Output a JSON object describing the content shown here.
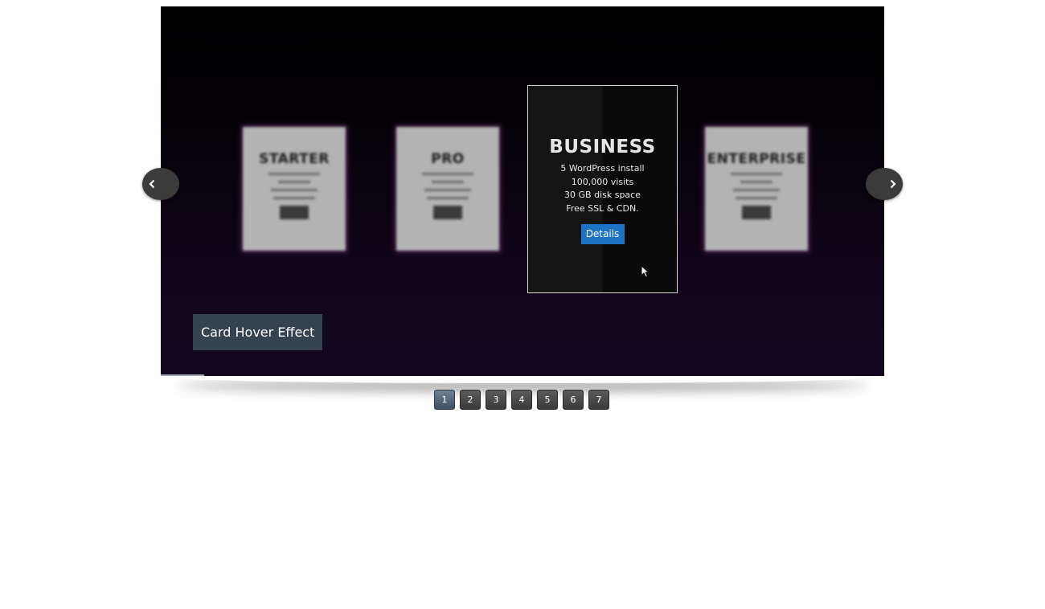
{
  "slider": {
    "caption": "Card Hover Effect",
    "cards": [
      {
        "title": "STARTER",
        "blurred": true
      },
      {
        "title": "PRO",
        "blurred": true
      },
      {
        "title": "BUSINESS",
        "features": [
          "5 WordPress install",
          "100,000 visits",
          "30 GB disk space",
          "Free SSL & CDN."
        ],
        "button_label": "Details"
      },
      {
        "title": "ENTERPRISE",
        "blurred": true
      }
    ],
    "progress_fraction": 0.06,
    "prev_icon": "chevron-left-icon",
    "next_icon": "chevron-right-icon"
  },
  "pager": {
    "pages": [
      "1",
      "2",
      "3",
      "4",
      "5",
      "6",
      "7"
    ],
    "active_index": 0
  },
  "colors": {
    "caption_bg": "#34434f",
    "details_button": "#1f73c4",
    "pager_active": "#4f6172"
  }
}
